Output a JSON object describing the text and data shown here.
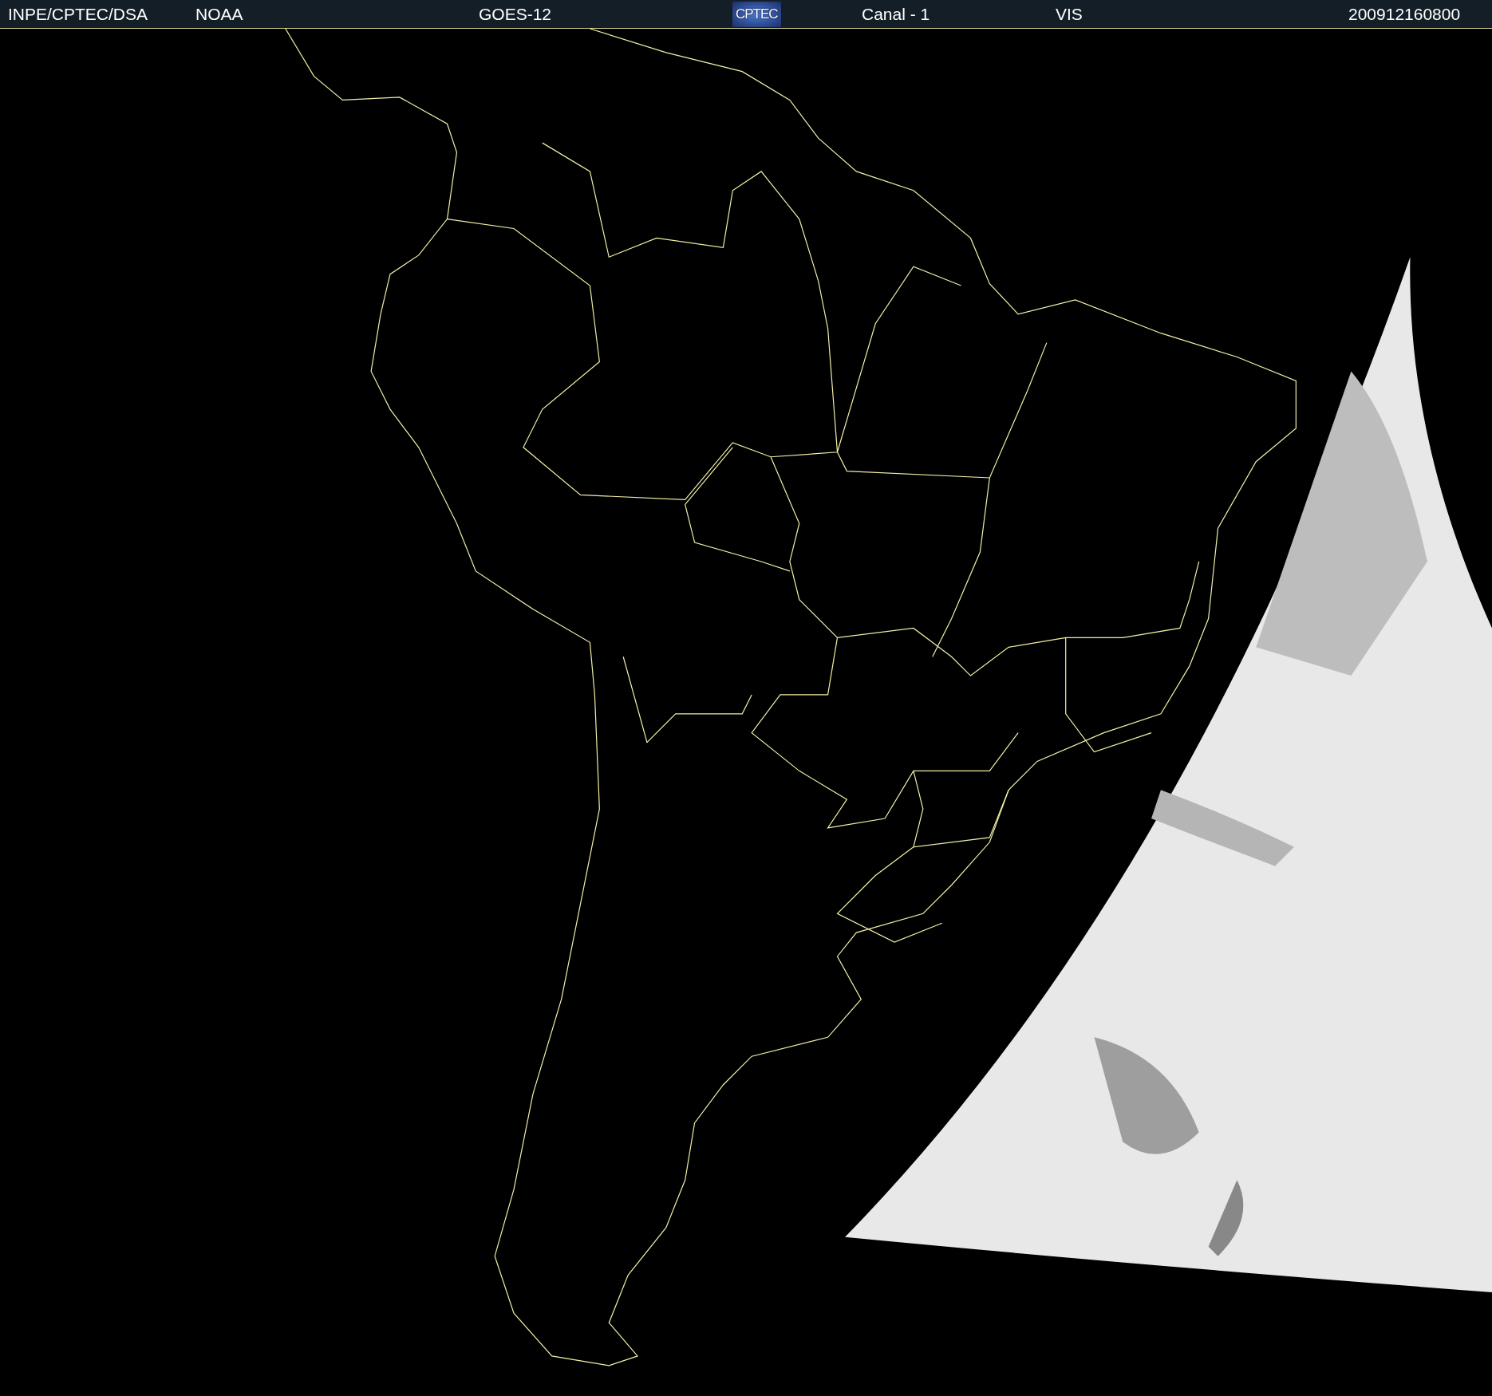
{
  "header": {
    "items": [
      {
        "kind": "text",
        "text": "INPE/CPTEC/DSA"
      },
      {
        "kind": "text",
        "text": "NOAA"
      },
      {
        "kind": "text",
        "text": "GOES-12"
      },
      {
        "kind": "logo",
        "text": "CPTEC"
      },
      {
        "kind": "text",
        "text": "Canal - 1"
      },
      {
        "kind": "text",
        "text": "VIS"
      },
      {
        "kind": "text",
        "text": "200912160800"
      }
    ]
  }
}
